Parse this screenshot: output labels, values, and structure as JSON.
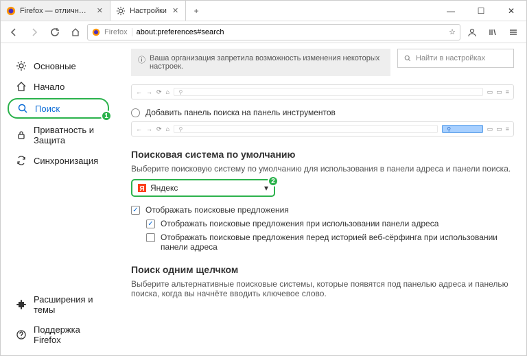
{
  "tabs": [
    {
      "label": "Firefox — отличный браузер д",
      "active": false
    },
    {
      "label": "Настройки",
      "active": true
    }
  ],
  "urlbar": {
    "prefix": "Firefox",
    "value": "about:preferences#search"
  },
  "sidebar": {
    "items": [
      {
        "label": "Основные"
      },
      {
        "label": "Начало"
      },
      {
        "label": "Поиск"
      },
      {
        "label": "Приватность и Защита"
      },
      {
        "label": "Синхронизация"
      }
    ],
    "bottom": [
      {
        "label": "Расширения и темы"
      },
      {
        "label": "Поддержка Firefox"
      }
    ]
  },
  "notice": "Ваша организация запретила возможность изменения некоторых настроек.",
  "find_placeholder": "Найти в настройках",
  "radio_add_search": "Добавить панель поиска на панель инструментов",
  "section_default": {
    "title": "Поисковая система по умолчанию",
    "desc": "Выберите поисковую систему по умолчанию для использования в панели адреса и панели поиска.",
    "engine": "Яндекс",
    "chk1": "Отображать поисковые предложения",
    "chk2": "Отображать поисковые предложения при использовании панели адреса",
    "chk3": "Отображать поисковые предложения перед историей веб-сёрфинга при использовании панели адреса"
  },
  "section_oneclick": {
    "title": "Поиск одним щелчком",
    "desc": "Выберите альтернативные поисковые системы, которые появятся под панелью адреса и панелью поиска, когда вы начнёте вводить ключевое слово."
  },
  "badges": {
    "one": "1",
    "two": "2"
  }
}
